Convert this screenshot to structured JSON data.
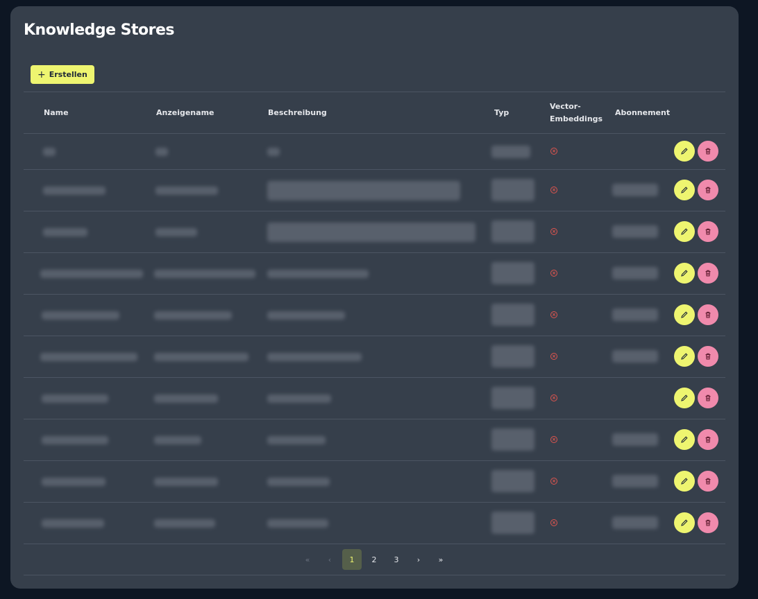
{
  "page": {
    "title": "Knowledge Stores"
  },
  "toolbar": {
    "create_label": "Erstellen"
  },
  "table": {
    "columns": {
      "name": "Name",
      "display_name": "Anzeigename",
      "description": "Beschreibung",
      "type": "Typ",
      "vector_embeddings": "Vector-Embeddings",
      "subscription": "Abonnement"
    },
    "rows_count_visible": 10
  },
  "pagination": {
    "first": "«",
    "prev": "‹",
    "pages": [
      "1",
      "2",
      "3"
    ],
    "current": "1",
    "next": "›",
    "last": "»"
  },
  "colors": {
    "background": "#0d1623",
    "card": "#363f4b",
    "accent_yellow": "#eef570",
    "delete_pink": "#f08aac",
    "error_red": "#e0554f"
  },
  "icons": {
    "create": "plus-icon",
    "vector_status": "x-circle-icon",
    "edit": "pencil-icon",
    "delete": "trash-icon"
  }
}
